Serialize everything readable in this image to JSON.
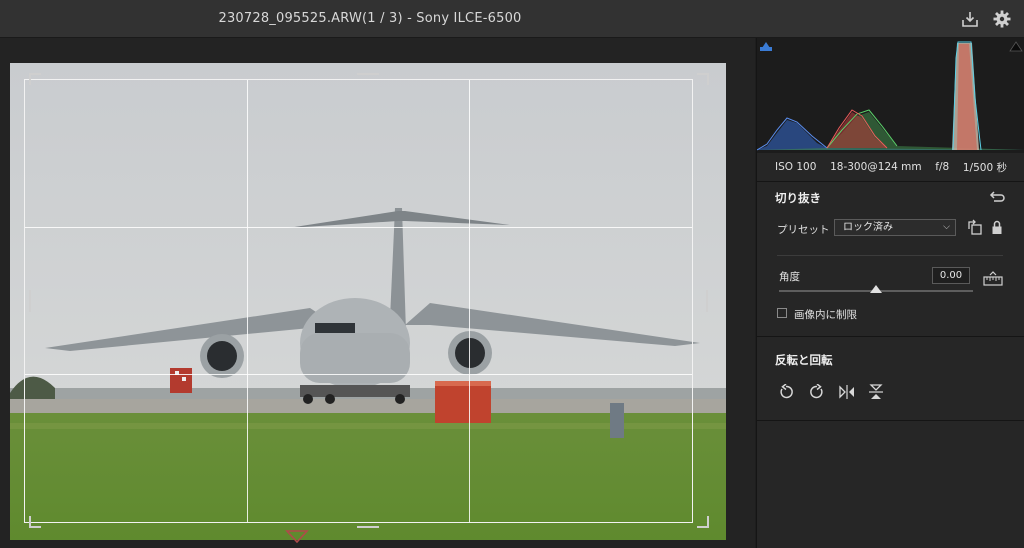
{
  "window": {
    "title": "230728_095525.ARW(1 / 3)  -  Sony ILCE-6500",
    "icons": [
      "download-icon",
      "gear-icon"
    ]
  },
  "exif": {
    "iso": "ISO 100",
    "lens": "18-300@124 mm",
    "aperture": "f/8",
    "shutter": "1/500 秒"
  },
  "crop_panel": {
    "title": "切り抜き",
    "preset_label": "プリセット",
    "preset_value": "ロック済み",
    "angle_label": "角度",
    "angle_value": "0.00",
    "angle_slider_fraction": 0.5,
    "constrain_label": "画像内に制限",
    "constrain_checked": false
  },
  "transform_panel": {
    "title": "反転と回転",
    "icons": [
      "rotate-left-icon",
      "rotate-right-icon",
      "flip-horizontal-icon",
      "flip-vertical-icon"
    ]
  },
  "colors": {
    "topbar": "#323232",
    "panel": "#262626",
    "accent_blue": "#3a7bd5"
  }
}
